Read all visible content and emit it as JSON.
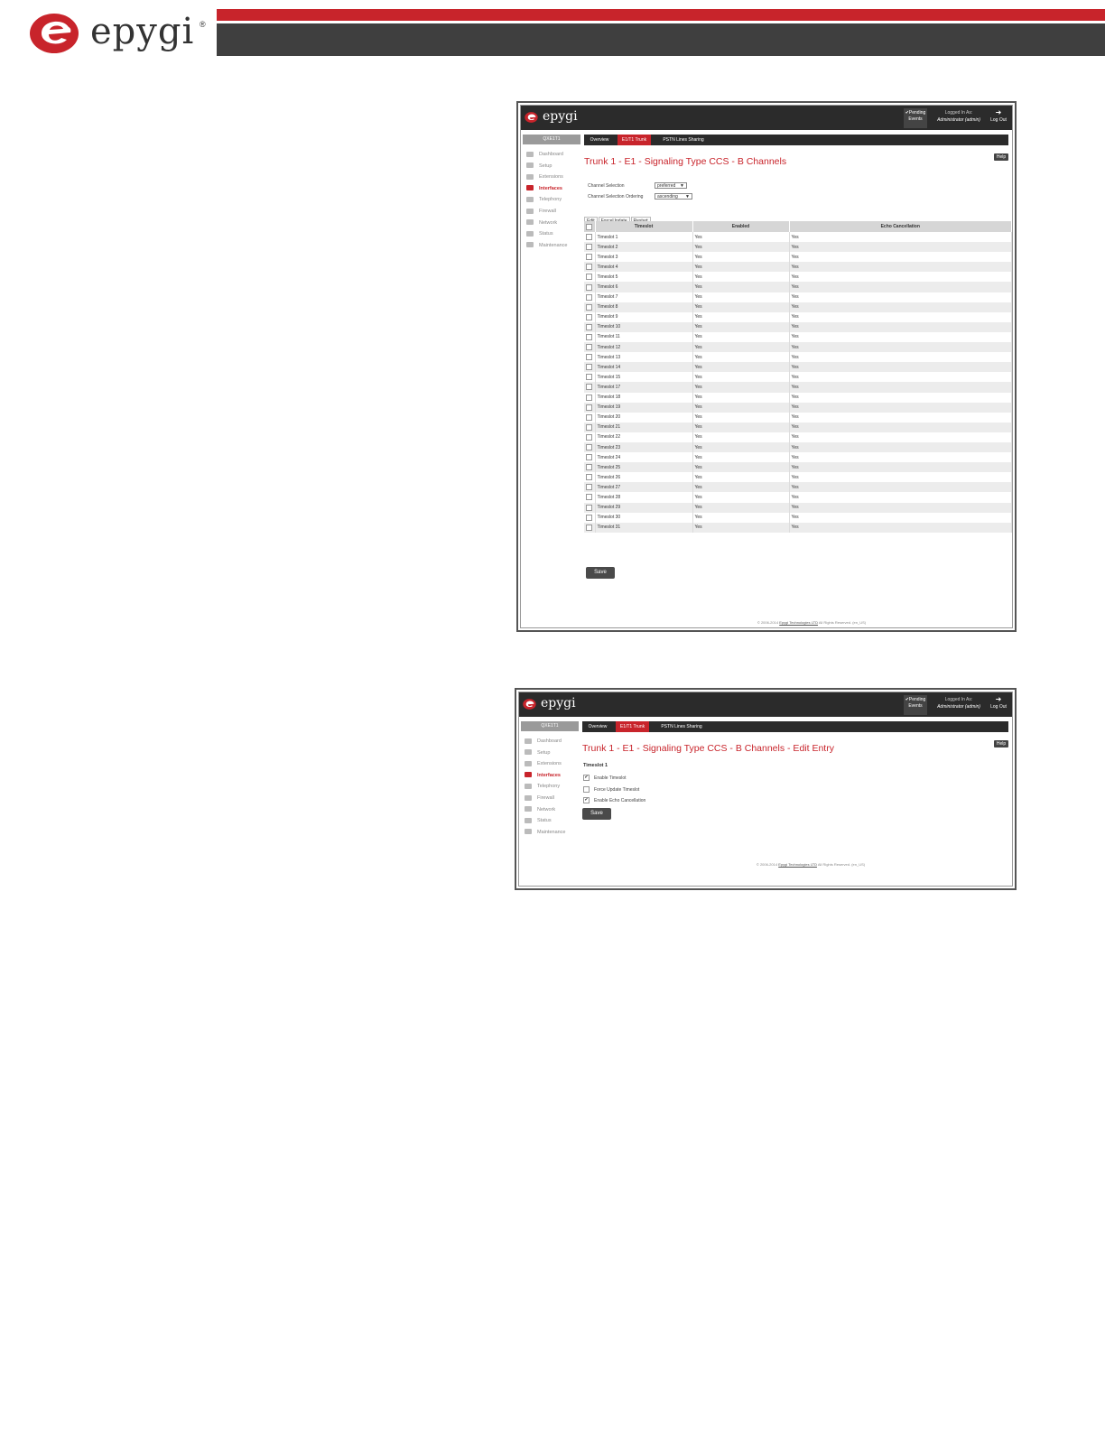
{
  "brand": {
    "logo_text": "epygi",
    "registered": "®",
    "accent": "#c8242b",
    "dark": "#3f3f3f"
  },
  "shared": {
    "topbar_logo": "epygi",
    "pending_events": "✔Pending Events",
    "logged_in_label": "Logged In As:",
    "logged_in_user": "Administrator (admin)",
    "logout": "Log Out",
    "device": "QXE1T1",
    "menu": [
      {
        "label": "Dashboard",
        "icon": "dashboard-icon"
      },
      {
        "label": "Setup",
        "icon": "gear-icon"
      },
      {
        "label": "Extensions",
        "icon": "book-icon"
      },
      {
        "label": "Interfaces",
        "icon": "plug-icon",
        "active": true
      },
      {
        "label": "Telephony",
        "icon": "phone-icon"
      },
      {
        "label": "Firewall",
        "icon": "fire-icon"
      },
      {
        "label": "Network",
        "icon": "globe-icon"
      },
      {
        "label": "Status",
        "icon": "chart-icon"
      },
      {
        "label": "Maintenance",
        "icon": "wrench-icon"
      }
    ],
    "tabs": [
      "Overview",
      "E1/T1 Trunk",
      "PSTN Lines Sharing"
    ],
    "help": "Help",
    "save": "Save",
    "footer_pre": "© 2006-2014",
    "footer_link": "Epygi Technologies LTD",
    "footer_post": "All Rights Reserved. (en_US)"
  },
  "screen1": {
    "title": "Trunk 1 - E1 - Signaling Type CCS - B Channels",
    "channel_selection_label": "Channel Selection",
    "channel_selection_value": "preferred",
    "channel_ordering_label": "Channel Selection Ordering",
    "channel_ordering_value": "ascending",
    "actions": [
      "Edit",
      "ForceUpdate",
      "Restart"
    ],
    "columns": [
      "",
      "Timeslot",
      "Enabled",
      "Echo Cancellation"
    ],
    "rows": [
      [
        "Timeslot 1",
        "Yes",
        "Yes"
      ],
      [
        "Timeslot 2",
        "Yes",
        "Yes"
      ],
      [
        "Timeslot 3",
        "Yes",
        "Yes"
      ],
      [
        "Timeslot 4",
        "Yes",
        "Yes"
      ],
      [
        "Timeslot 5",
        "Yes",
        "Yes"
      ],
      [
        "Timeslot 6",
        "Yes",
        "Yes"
      ],
      [
        "Timeslot 7",
        "Yes",
        "Yes"
      ],
      [
        "Timeslot 8",
        "Yes",
        "Yes"
      ],
      [
        "Timeslot 9",
        "Yes",
        "Yes"
      ],
      [
        "Timeslot 10",
        "Yes",
        "Yes"
      ],
      [
        "Timeslot 11",
        "Yes",
        "Yes"
      ],
      [
        "Timeslot 12",
        "Yes",
        "Yes"
      ],
      [
        "Timeslot 13",
        "Yes",
        "Yes"
      ],
      [
        "Timeslot 14",
        "Yes",
        "Yes"
      ],
      [
        "Timeslot 15",
        "Yes",
        "Yes"
      ],
      [
        "Timeslot 17",
        "Yes",
        "Yes"
      ],
      [
        "Timeslot 18",
        "Yes",
        "Yes"
      ],
      [
        "Timeslot 19",
        "Yes",
        "Yes"
      ],
      [
        "Timeslot 20",
        "Yes",
        "Yes"
      ],
      [
        "Timeslot 21",
        "Yes",
        "Yes"
      ],
      [
        "Timeslot 22",
        "Yes",
        "Yes"
      ],
      [
        "Timeslot 23",
        "Yes",
        "Yes"
      ],
      [
        "Timeslot 24",
        "Yes",
        "Yes"
      ],
      [
        "Timeslot 25",
        "Yes",
        "Yes"
      ],
      [
        "Timeslot 26",
        "Yes",
        "Yes"
      ],
      [
        "Timeslot 27",
        "Yes",
        "Yes"
      ],
      [
        "Timeslot 28",
        "Yes",
        "Yes"
      ],
      [
        "Timeslot 29",
        "Yes",
        "Yes"
      ],
      [
        "Timeslot 30",
        "Yes",
        "Yes"
      ],
      [
        "Timeslot 31",
        "Yes",
        "Yes"
      ]
    ]
  },
  "screen2": {
    "title": "Trunk 1 - E1 - Signaling Type CCS - B Channels - Edit Entry",
    "subheading": "Timeslot 1",
    "options": [
      {
        "label": "Enable Timeslot",
        "checked": true
      },
      {
        "label": "Force Update Timeslot",
        "checked": false
      },
      {
        "label": "Enable Echo Cancellation",
        "checked": true
      }
    ]
  }
}
